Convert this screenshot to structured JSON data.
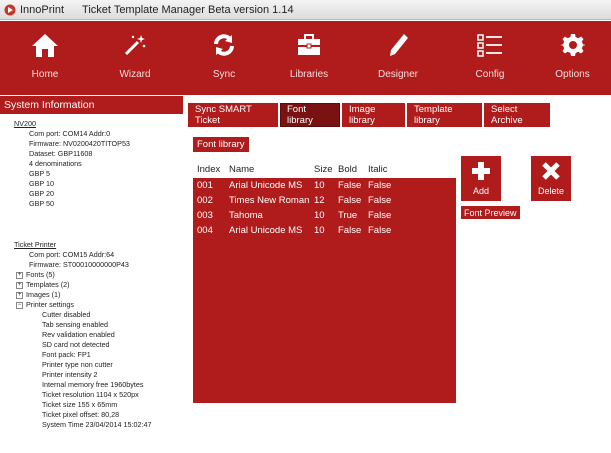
{
  "window": {
    "app_name": "InnoPrint",
    "title": "Ticket Template Manager Beta version 1.14"
  },
  "toolbar": [
    {
      "label": "Home",
      "icon": "home-icon"
    },
    {
      "label": "Wizard",
      "icon": "magic-wand-icon"
    },
    {
      "label": "Sync",
      "icon": "sync-icon"
    },
    {
      "label": "Libraries",
      "icon": "briefcase-icon"
    },
    {
      "label": "Designer",
      "icon": "pencil-icon"
    },
    {
      "label": "Config",
      "icon": "checklist-icon"
    },
    {
      "label": "Options",
      "icon": "gear-icon"
    }
  ],
  "system_info": {
    "header": "System Information",
    "nv200": {
      "title": "NV200",
      "lines": [
        "Com port: COM14 Addr:0",
        "Firmware: NV0200420TITOP53",
        "Dataset: GBP11608",
        "4 denominations",
        "GBP 5",
        "GBP 10",
        "GBP 20",
        "GBP 50"
      ]
    },
    "printer": {
      "title": "Ticket Printer",
      "lines": [
        "Com port: COM15 Addr:64",
        "Firmware: ST00010000000P43"
      ],
      "fonts": "Fonts (5)",
      "templates": "Templates (2)",
      "images": "Images (1)",
      "settings": "Printer settings",
      "settings_lines": [
        "Cutter disabled",
        "Tab sensing enabled",
        "Rev validation enabled",
        "SD card not detected",
        "Font pack: FP1",
        "Printer type non cutter",
        "Printer intensity 2",
        "Internal memory free 1960bytes",
        "Ticket resolution 1104 x 520px",
        "Ticket size 155 x 65mm",
        "Ticket pixel offset: 80,28",
        "System Time 23/04/2014 15:02:47"
      ]
    }
  },
  "tabs": [
    {
      "label": "Sync SMART Ticket",
      "active": false
    },
    {
      "label": "Font library",
      "active": true
    },
    {
      "label": "Image library",
      "active": false
    },
    {
      "label": "Template library",
      "active": false
    },
    {
      "label": "Select Archive",
      "active": false
    }
  ],
  "font_library": {
    "section_label": "Font library",
    "columns": [
      "Index",
      "Name",
      "Size",
      "Bold",
      "Italic"
    ],
    "rows": [
      [
        "001",
        "Arial Unicode MS",
        "10",
        "False",
        "False"
      ],
      [
        "002",
        "Times New Roman",
        "12",
        "False",
        "False"
      ],
      [
        "003",
        "Tahoma",
        "10",
        "True",
        "False"
      ],
      [
        "004",
        "Arial Unicode MS",
        "10",
        "False",
        "False"
      ]
    ],
    "add_label": "Add",
    "delete_label": "Delete",
    "preview_label": "Font Preview"
  },
  "colors": {
    "accent": "#b01c1c",
    "accent_dark": "#7a1212"
  }
}
